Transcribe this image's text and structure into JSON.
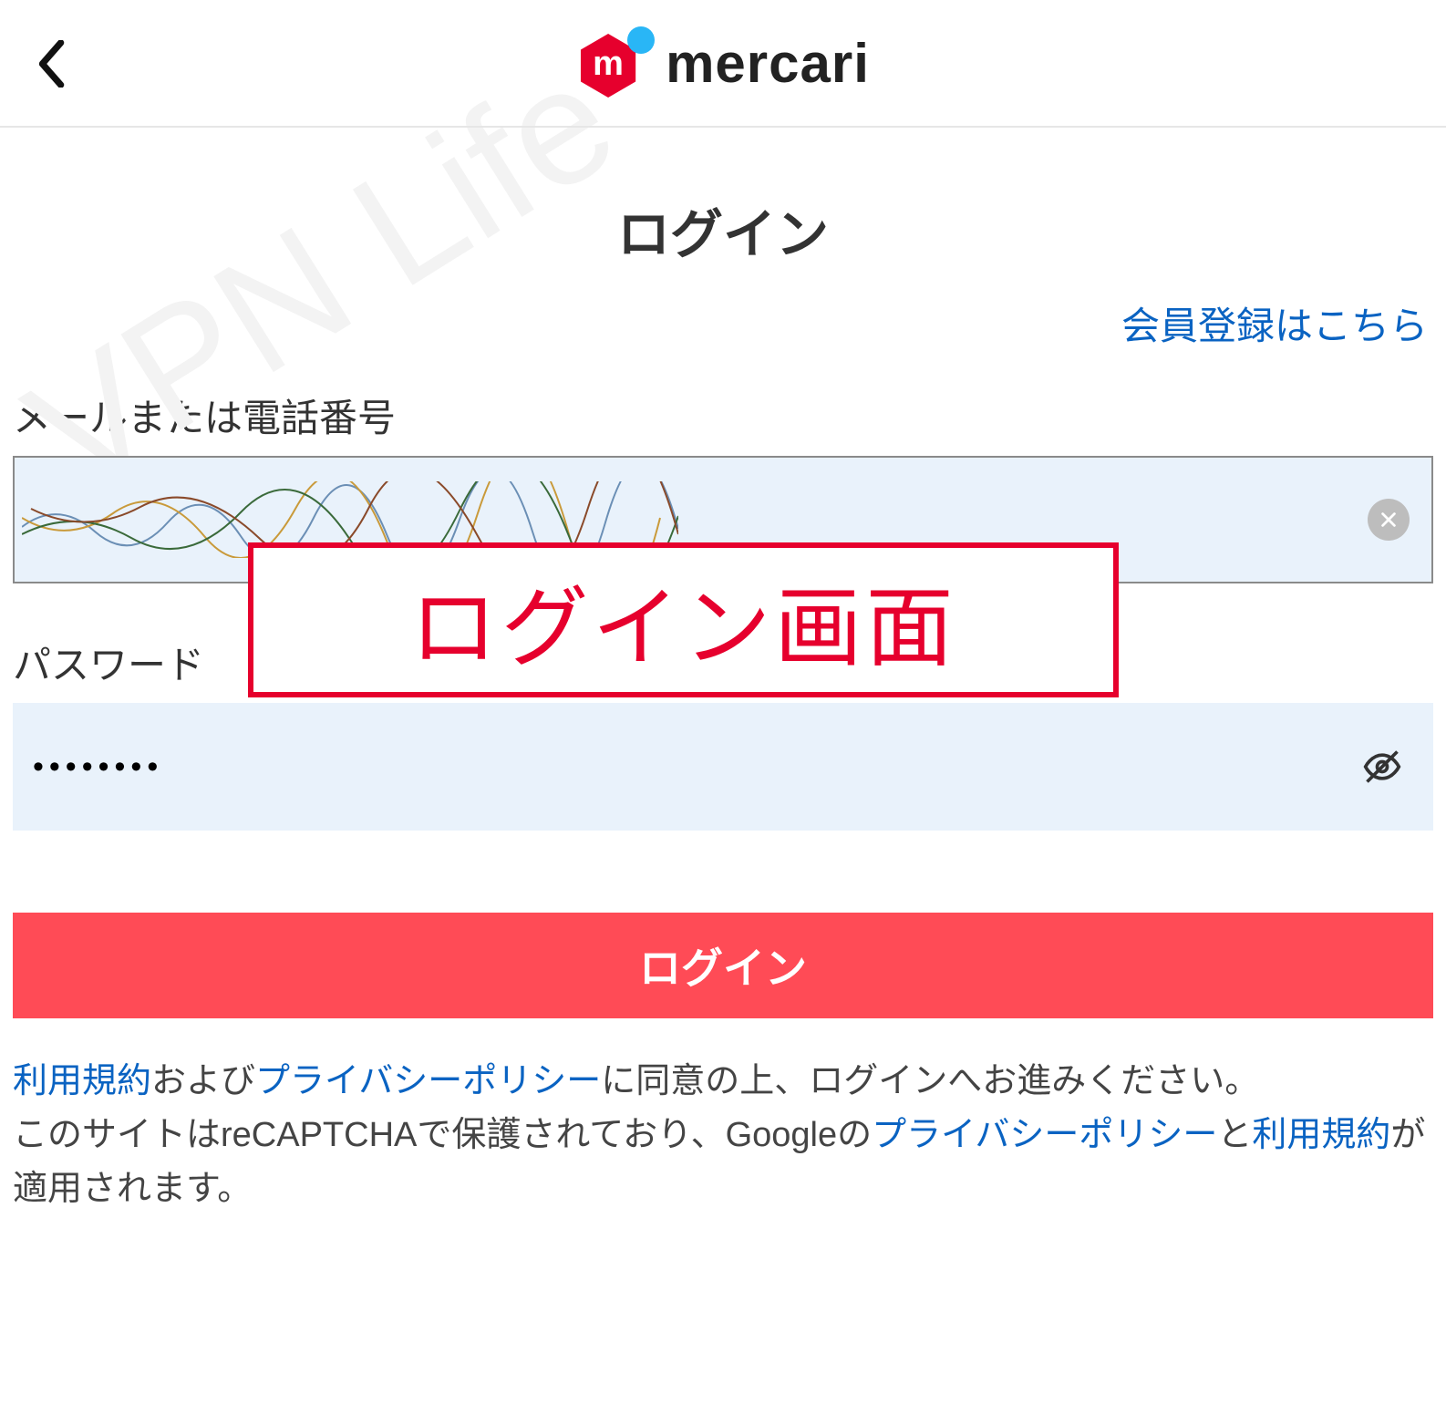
{
  "brand": {
    "name": "mercari",
    "logo_letter": "m"
  },
  "page": {
    "title": "ログイン",
    "register_link": "会員登録はこちら"
  },
  "fields": {
    "email_label": "メールまたは電話番号",
    "email_value": "",
    "password_label": "パスワード",
    "password_value": "••••••••"
  },
  "buttons": {
    "login": "ログイン"
  },
  "legal": {
    "t_tos_1": "利用規約",
    "t_and": "および",
    "t_pp_1": "プライバシーポリシー",
    "t_rest_1": "に同意の上、ログインへお進みください。",
    "t_line2_a": "このサイトはreCAPTCHAで保護されており、Googleの",
    "t_pp_2": "プライバシーポリシー",
    "t_and2": "と",
    "t_tos_2": "利用規約",
    "t_tail": "が適用されます。"
  },
  "annotation": {
    "overlay_text": "ログイン画面",
    "watermark": "VPN Life"
  }
}
